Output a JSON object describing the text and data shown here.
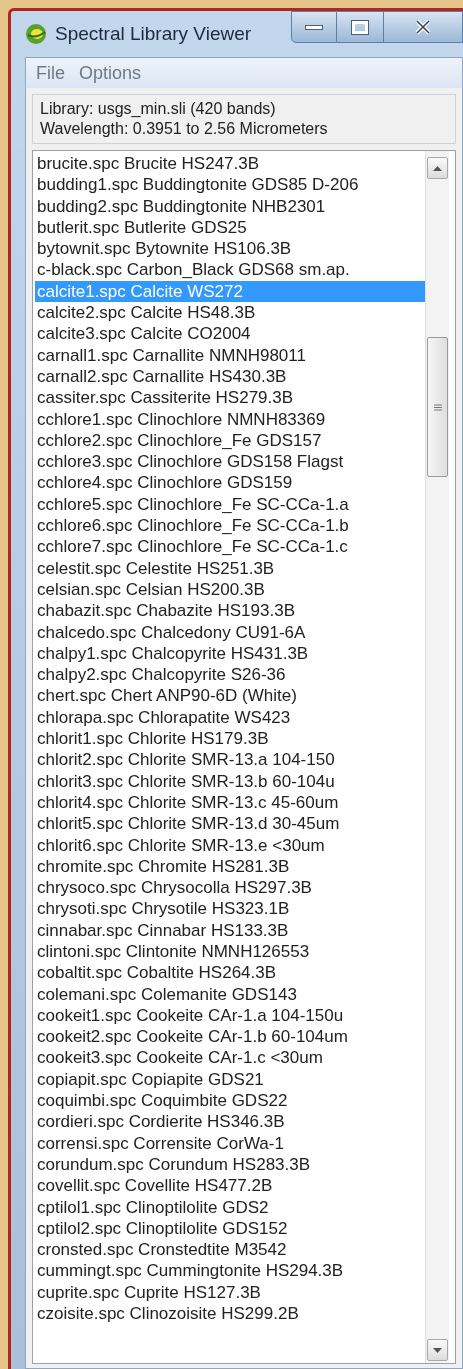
{
  "window": {
    "title": "Spectral Library Viewer"
  },
  "menu": [
    {
      "label": "File"
    },
    {
      "label": "Options"
    }
  ],
  "info": [
    "Library: usgs_min.sli (420 bands)",
    "Wavelength: 0.3951 to 2.56 Micrometers"
  ],
  "list": {
    "items": [
      {
        "label": "brucite.spc Brucite HS247.3B",
        "selected": false
      },
      {
        "label": "budding1.spc Buddingtonite GDS85 D-206",
        "selected": false
      },
      {
        "label": "budding2.spc Buddingtonite NHB2301",
        "selected": false
      },
      {
        "label": "butlerit.spc Butlerite GDS25",
        "selected": false
      },
      {
        "label": "bytownit.spc Bytownite HS106.3B",
        "selected": false
      },
      {
        "label": "c-black.spc Carbon_Black GDS68 sm.ap.",
        "selected": false
      },
      {
        "label": "calcite1.spc Calcite WS272",
        "selected": true
      },
      {
        "label": "calcite2.spc Calcite HS48.3B",
        "selected": false
      },
      {
        "label": "calcite3.spc Calcite CO2004",
        "selected": false
      },
      {
        "label": "carnall1.spc Carnallite NMNH98011",
        "selected": false
      },
      {
        "label": "carnall2.spc Carnallite HS430.3B",
        "selected": false
      },
      {
        "label": "cassiter.spc Cassiterite HS279.3B",
        "selected": false
      },
      {
        "label": "cchlore1.spc Clinochlore NMNH83369",
        "selected": false
      },
      {
        "label": "cchlore2.spc Clinochlore_Fe GDS157",
        "selected": false
      },
      {
        "label": "cchlore3.spc Clinochlore GDS158 Flagst",
        "selected": false
      },
      {
        "label": "cchlore4.spc Clinochlore GDS159",
        "selected": false
      },
      {
        "label": "cchlore5.spc Clinochlore_Fe SC-CCa-1.a",
        "selected": false
      },
      {
        "label": "cchlore6.spc Clinochlore_Fe SC-CCa-1.b",
        "selected": false
      },
      {
        "label": "cchlore7.spc Clinochlore_Fe SC-CCa-1.c",
        "selected": false
      },
      {
        "label": "celestit.spc Celestite HS251.3B",
        "selected": false
      },
      {
        "label": "celsian.spc Celsian HS200.3B",
        "selected": false
      },
      {
        "label": "chabazit.spc Chabazite HS193.3B",
        "selected": false
      },
      {
        "label": "chalcedo.spc Chalcedony CU91-6A",
        "selected": false
      },
      {
        "label": "chalpy1.spc Chalcopyrite HS431.3B",
        "selected": false
      },
      {
        "label": "chalpy2.spc Chalcopyrite S26-36",
        "selected": false
      },
      {
        "label": "chert.spc Chert ANP90-6D (White)",
        "selected": false
      },
      {
        "label": "chlorapa.spc Chlorapatite WS423",
        "selected": false
      },
      {
        "label": "chlorit1.spc Chlorite HS179.3B",
        "selected": false
      },
      {
        "label": "chlorit2.spc Chlorite SMR-13.a 104-150",
        "selected": false
      },
      {
        "label": "chlorit3.spc Chlorite SMR-13.b 60-104u",
        "selected": false
      },
      {
        "label": "chlorit4.spc Chlorite SMR-13.c 45-60um",
        "selected": false
      },
      {
        "label": "chlorit5.spc Chlorite SMR-13.d 30-45um",
        "selected": false
      },
      {
        "label": "chlorit6.spc Chlorite SMR-13.e <30um",
        "selected": false
      },
      {
        "label": "chromite.spc Chromite HS281.3B",
        "selected": false
      },
      {
        "label": "chrysoco.spc Chrysocolla HS297.3B",
        "selected": false
      },
      {
        "label": "chrysoti.spc Chrysotile HS323.1B",
        "selected": false
      },
      {
        "label": "cinnabar.spc Cinnabar HS133.3B",
        "selected": false
      },
      {
        "label": "clintoni.spc Clintonite NMNH126553",
        "selected": false
      },
      {
        "label": "cobaltit.spc Cobaltite HS264.3B",
        "selected": false
      },
      {
        "label": "colemani.spc Colemanite GDS143",
        "selected": false
      },
      {
        "label": "cookeit1.spc Cookeite CAr-1.a 104-150u",
        "selected": false
      },
      {
        "label": "cookeit2.spc Cookeite CAr-1.b 60-104um",
        "selected": false
      },
      {
        "label": "cookeit3.spc Cookeite CAr-1.c <30um",
        "selected": false
      },
      {
        "label": "copiapit.spc Copiapite GDS21",
        "selected": false
      },
      {
        "label": "coquimbi.spc Coquimbite GDS22",
        "selected": false
      },
      {
        "label": "cordieri.spc Cordierite HS346.3B",
        "selected": false
      },
      {
        "label": "corrensi.spc Corrensite CorWa-1",
        "selected": false
      },
      {
        "label": "corundum.spc Corundum HS283.3B",
        "selected": false
      },
      {
        "label": "covellit.spc Covellite HS477.2B",
        "selected": false
      },
      {
        "label": "cptilol1.spc Clinoptilolite GDS2",
        "selected": false
      },
      {
        "label": "cptilol2.spc Clinoptilolite GDS152",
        "selected": false
      },
      {
        "label": "cronsted.spc Cronstedtite M3542",
        "selected": false
      },
      {
        "label": "cummingt.spc Cummingtonite HS294.3B",
        "selected": false
      },
      {
        "label": "cuprite.spc Cuprite HS127.3B",
        "selected": false
      },
      {
        "label": "czoisite.spc Clinozoisite HS299.2B",
        "selected": false
      }
    ]
  }
}
